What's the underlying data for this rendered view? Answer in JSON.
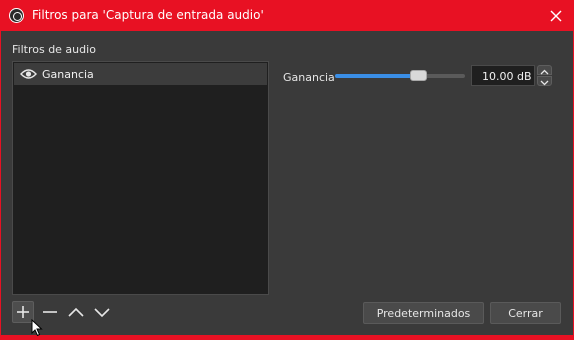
{
  "window": {
    "title": "Filtros para 'Captura de entrada audio'",
    "accent_color": "#e81123",
    "icons": {
      "app": "obs-logo-icon",
      "close": "close-icon"
    }
  },
  "filters_panel": {
    "label": "Filtros de audio",
    "items": [
      {
        "name": "Ganancia",
        "visible": true,
        "icon": "eye-icon",
        "selected": true
      }
    ]
  },
  "properties": {
    "gain": {
      "label": "Ganancia",
      "value_text": "10.00 dB",
      "slider_level_fraction": 0.64,
      "slider_color": "#3a8ee6"
    }
  },
  "toolbar": {
    "buttons": [
      {
        "name": "add",
        "icon": "plus-icon"
      },
      {
        "name": "remove",
        "icon": "minus-icon"
      },
      {
        "name": "move-up",
        "icon": "chevron-up-icon"
      },
      {
        "name": "move-down",
        "icon": "chevron-down-icon"
      }
    ]
  },
  "dialog_buttons": {
    "defaults_label": "Predeterminados",
    "close_label": "Cerrar"
  }
}
